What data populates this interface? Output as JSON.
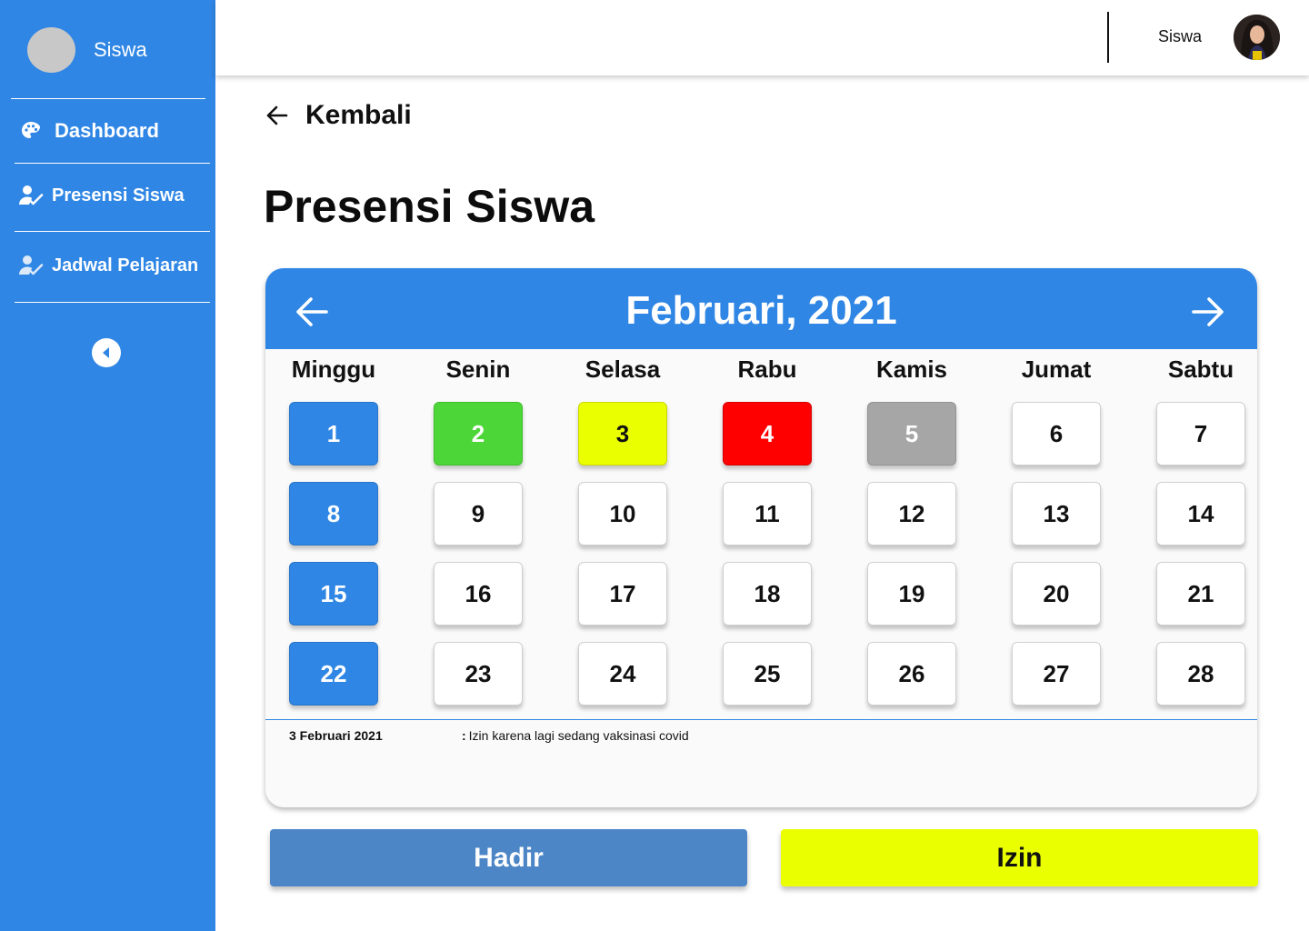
{
  "sidebar": {
    "username": "Siswa",
    "items": [
      {
        "label": "Dashboard",
        "icon": "palette-icon"
      },
      {
        "label": "Presensi Siswa",
        "icon": "user-check-icon"
      },
      {
        "label": "Jadwal Pelajaran",
        "icon": "user-check-icon"
      }
    ],
    "collapse_icon": "chevron-left-icon"
  },
  "topbar": {
    "username": "Siswa"
  },
  "back_label": "Kembali",
  "page_title": "Presensi Siswa",
  "calendar": {
    "month_label": "Februari, 2021",
    "weekdays": [
      "Minggu",
      "Senin",
      "Selasa",
      "Rabu",
      "Kamis",
      "Jumat",
      "Sabtu"
    ],
    "days": [
      {
        "n": "1",
        "status": "blue"
      },
      {
        "n": "2",
        "status": "green"
      },
      {
        "n": "3",
        "status": "yellow"
      },
      {
        "n": "4",
        "status": "red"
      },
      {
        "n": "5",
        "status": "grey"
      },
      {
        "n": "6",
        "status": "default"
      },
      {
        "n": "7",
        "status": "default"
      },
      {
        "n": "8",
        "status": "blue"
      },
      {
        "n": "9",
        "status": "default"
      },
      {
        "n": "10",
        "status": "default"
      },
      {
        "n": "11",
        "status": "default"
      },
      {
        "n": "12",
        "status": "default"
      },
      {
        "n": "13",
        "status": "default"
      },
      {
        "n": "14",
        "status": "default"
      },
      {
        "n": "15",
        "status": "blue"
      },
      {
        "n": "16",
        "status": "default"
      },
      {
        "n": "17",
        "status": "default"
      },
      {
        "n": "18",
        "status": "default"
      },
      {
        "n": "19",
        "status": "default"
      },
      {
        "n": "20",
        "status": "default"
      },
      {
        "n": "21",
        "status": "default"
      },
      {
        "n": "22",
        "status": "blue"
      },
      {
        "n": "23",
        "status": "default"
      },
      {
        "n": "24",
        "status": "default"
      },
      {
        "n": "25",
        "status": "default"
      },
      {
        "n": "26",
        "status": "default"
      },
      {
        "n": "27",
        "status": "default"
      },
      {
        "n": "28",
        "status": "default"
      }
    ],
    "note": {
      "date": "3 Februari 2021",
      "colon": ":",
      "text": "Izin karena lagi sedang vaksinasi covid"
    }
  },
  "buttons": {
    "hadir": "Hadir",
    "izin": "Izin"
  },
  "colors": {
    "primary": "#2f86e4",
    "green": "#4dd637",
    "yellow": "#eaff00",
    "red": "#ff0000",
    "grey": "#a6a6a6",
    "hadir_button": "#4c86c6"
  }
}
